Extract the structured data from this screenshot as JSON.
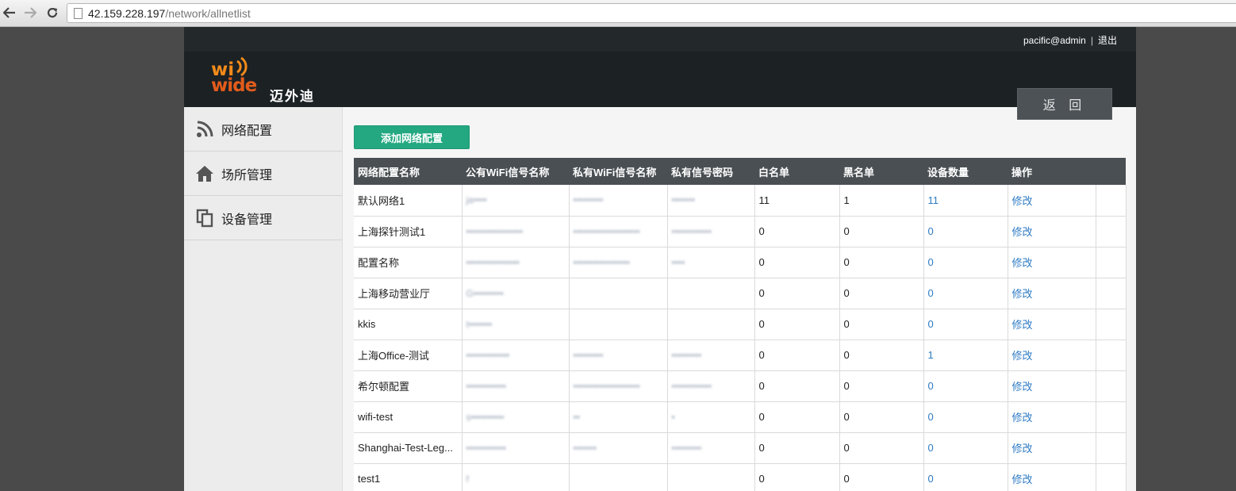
{
  "browser": {
    "url_host": "42.159.228.197",
    "url_path": "/network/allnetlist"
  },
  "topbar": {
    "user": "pacific@admin",
    "separator": "|",
    "logout_label": "退出"
  },
  "header": {
    "logo_wi": "wi",
    "logo_wide": "wide",
    "logo_cn": "迈外迪",
    "back_label": "返 回"
  },
  "sidebar": {
    "items": [
      {
        "label": "网络配置",
        "icon": "rss-icon"
      },
      {
        "label": "场所管理",
        "icon": "home-icon"
      },
      {
        "label": "设备管理",
        "icon": "copy-icon"
      }
    ]
  },
  "main": {
    "add_button_label": "添加网络配置",
    "table": {
      "columns": [
        "网络配置名称",
        "公有WiFi信号名称",
        "私有WiFi信号名称",
        "私有信号密码",
        "白名单",
        "黑名单",
        "设备数量",
        "操作"
      ],
      "rows": [
        {
          "name": "默认网络1",
          "public_ssid": "ja••••",
          "private_ssid": "•••••••••",
          "password": "•••••••",
          "whitelist": "11",
          "blacklist": "1",
          "devices": "11",
          "action": "修改"
        },
        {
          "name": "上海探针测试1",
          "public_ssid": "•••••••••••••••••",
          "private_ssid": "••••••••••••••••••••",
          "password": "••••••••••••",
          "whitelist": "0",
          "blacklist": "0",
          "devices": "0",
          "action": "修改"
        },
        {
          "name": "配置名称",
          "public_ssid": "••••••••••••••••",
          "private_ssid": "•••••••••••••••••",
          "password": "••••",
          "whitelist": "0",
          "blacklist": "0",
          "devices": "0",
          "action": "修改"
        },
        {
          "name": "上海移动营业厅",
          "public_ssid": "G•••••••••",
          "private_ssid": "",
          "password": "",
          "whitelist": "0",
          "blacklist": "0",
          "devices": "0",
          "action": "修改"
        },
        {
          "name": "kkis",
          "public_ssid": "t•••••••",
          "private_ssid": "",
          "password": "",
          "whitelist": "0",
          "blacklist": "0",
          "devices": "0",
          "action": "修改"
        },
        {
          "name": "上海Office-测试",
          "public_ssid": "•••••••••••••",
          "private_ssid": "•••••••••",
          "password": "•••••••••",
          "whitelist": "0",
          "blacklist": "0",
          "devices": "1",
          "action": "修改"
        },
        {
          "name": "希尔顿配置",
          "public_ssid": "••••••••••••",
          "private_ssid": "••••••••••••••••••••",
          "password": "••••••••••••",
          "whitelist": "0",
          "blacklist": "0",
          "devices": "0",
          "action": "修改"
        },
        {
          "name": "wifi-test",
          "public_ssid": "s••••••••••",
          "private_ssid": "••",
          "password": "•",
          "whitelist": "0",
          "blacklist": "0",
          "devices": "0",
          "action": "修改"
        },
        {
          "name": "Shanghai-Test-Leg...",
          "public_ssid": "••••••••••••",
          "private_ssid": "•••••••",
          "password": "•••••••••",
          "whitelist": "0",
          "blacklist": "0",
          "devices": "0",
          "action": "修改"
        },
        {
          "name": "test1",
          "public_ssid": "f",
          "private_ssid": "",
          "password": "",
          "whitelist": "0",
          "blacklist": "0",
          "devices": "0",
          "action": "修改"
        }
      ]
    }
  },
  "colors": {
    "accent_green": "#24a881",
    "link_blue": "#2e7bc4",
    "header_dark": "#1c2124"
  }
}
